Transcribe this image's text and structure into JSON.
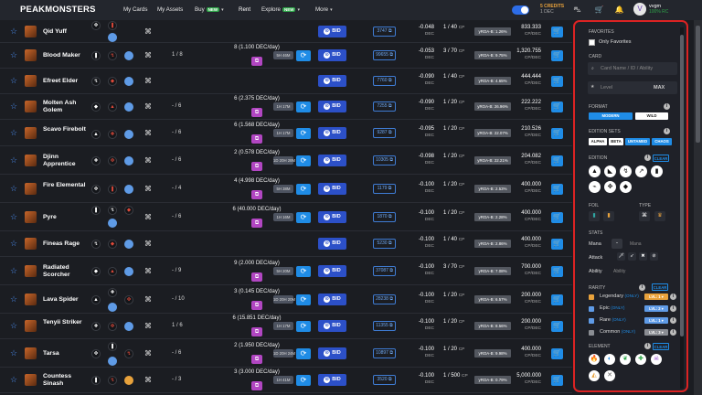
{
  "nav": {
    "logo": "PEAKMONSTERS",
    "items": [
      {
        "label": "My Cards"
      },
      {
        "label": "My Assets"
      },
      {
        "label": "Buy",
        "badge": "NEW"
      },
      {
        "label": "Rent"
      },
      {
        "label": "Explore",
        "badge": "NEW"
      },
      {
        "label": "More"
      }
    ],
    "credits_line1": "5 CREDITS",
    "credits_line2": "1 DEC",
    "user_initial": "V",
    "username": "vvgm",
    "rc": "100% RC"
  },
  "rows": [
    {
      "name": "Qid Yuff",
      "own": "",
      "rent": "",
      "rent_tag": "",
      "qty": "3747",
      "bc": "-0.048",
      "unit": "DEC",
      "levels": "1 / 40",
      "cp": "CP",
      "yield": "yROA-B: 1.26%",
      "price": "833.333",
      "price_unit": "CP/DEC"
    },
    {
      "name": "Blood Maker",
      "own": "1 / 8",
      "rent": "8 (1.100 DEC/day)",
      "rent_tag": "5H 46M",
      "qty": "99655",
      "bc": "-0.053",
      "unit": "DEC",
      "levels": "3 / 70",
      "cp": "CP",
      "yield": "yROA-B: 9.75%",
      "price": "1,320.755",
      "price_unit": "CP/DEC"
    },
    {
      "name": "Efreet Elder",
      "own": "",
      "rent": "",
      "rent_tag": "",
      "qty": "7760",
      "bc": "-0.090",
      "unit": "DEC",
      "levels": "1 / 40",
      "cp": "CP",
      "yield": "yROA-B: 4.65%",
      "price": "444.444",
      "price_unit": "CP/DEC"
    },
    {
      "name": "Molten Ash Golem",
      "own": "- / 6",
      "rent": "6 (2.375 DEC/day)",
      "rent_tag": "1H 17M",
      "qty": "7255",
      "bc": "-0.090",
      "unit": "DEC",
      "levels": "1 / 20",
      "cp": "CP",
      "yield": "yROA-B: 26.96%",
      "price": "222.222",
      "price_unit": "CP/DEC"
    },
    {
      "name": "Scavo Firebolt",
      "own": "- / 6",
      "rent": "6 (1.568 DEC/day)",
      "rent_tag": "1H 17M",
      "qty": "9287",
      "bc": "-0.095",
      "unit": "DEC",
      "levels": "1 / 20",
      "cp": "CP",
      "yield": "yROA-B: 22.07%",
      "price": "210.526",
      "price_unit": "CP/DEC"
    },
    {
      "name": "Djinn Apprentice",
      "own": "- / 6",
      "rent": "2 (0.578 DEC/day)",
      "rent_tag": "1D 20H 28M",
      "qty": "10305",
      "bc": "-0.098",
      "unit": "DEC",
      "levels": "1 / 20",
      "cp": "CP",
      "yield": "yROA-B: 22.21%",
      "price": "204.082",
      "price_unit": "CP/DEC"
    },
    {
      "name": "Fire Elemental",
      "own": "- / 4",
      "rent": "4 (4.998 DEC/day)",
      "rent_tag": "5H 38M",
      "qty": "1179",
      "bc": "-0.100",
      "unit": "DEC",
      "levels": "1 / 20",
      "cp": "CP",
      "yield": "yROA-B: 2.53%",
      "price": "400.000",
      "price_unit": "CP/DEC"
    },
    {
      "name": "Pyre",
      "own": "- / 6",
      "rent": "6 (40.000 DEC/day)",
      "rent_tag": "1H 16M",
      "qty": "1870",
      "bc": "-0.100",
      "unit": "DEC",
      "levels": "1 / 20",
      "cp": "CP",
      "yield": "yROA-B: 2.28%",
      "price": "400.000",
      "price_unit": "CP/DEC"
    },
    {
      "name": "Fineas Rage",
      "own": "",
      "rent": "",
      "rent_tag": "",
      "qty": "5230",
      "bc": "-0.100",
      "unit": "DEC",
      "levels": "1 / 40",
      "cp": "CP",
      "yield": "yROA-B: 2.86%",
      "price": "400.000",
      "price_unit": "CP/DEC"
    },
    {
      "name": "Radiated Scorcher",
      "own": "- / 9",
      "rent": "9 (2.000 DEC/day)",
      "rent_tag": "5H 20M",
      "qty": "37087",
      "bc": "-0.100",
      "unit": "DEC",
      "levels": "3 / 70",
      "cp": "CP",
      "yield": "yROA-B: 7.08%",
      "price": "700.000",
      "price_unit": "CP/DEC"
    },
    {
      "name": "Lava Spider",
      "own": "- / 10",
      "rent": "3 (0.145 DEC/day)",
      "rent_tag": "1D 20H 20M",
      "qty": "28238",
      "bc": "-0.100",
      "unit": "DEC",
      "levels": "1 / 20",
      "cp": "CP",
      "yield": "yROA-B: 6.57%",
      "price": "200.000",
      "price_unit": "CP/DEC"
    },
    {
      "name": "Tenyii Striker",
      "own": "1 / 6",
      "rent": "6 (15.851 DEC/day)",
      "rent_tag": "1H 17M",
      "qty": "11355",
      "bc": "-0.100",
      "unit": "DEC",
      "levels": "1 / 20",
      "cp": "CP",
      "yield": "yROA-B: 8.56%",
      "price": "200.000",
      "price_unit": "CP/DEC"
    },
    {
      "name": "Tarsa",
      "own": "- / 6",
      "rent": "2 (1.950 DEC/day)",
      "rent_tag": "1D 20H 24M",
      "qty": "10897",
      "bc": "-0.100",
      "unit": "DEC",
      "levels": "1 / 20",
      "cp": "CP",
      "yield": "yROA-B: 9.98%",
      "price": "400.000",
      "price_unit": "CP/DEC"
    },
    {
      "name": "Countess Sinash",
      "own": "- / 3",
      "rent": "3 (3.000 DEC/day)",
      "rent_tag": "1H 41M",
      "qty": "3520",
      "bc": "-0.100",
      "unit": "DEC",
      "levels": "1 / 500",
      "cp": "CP",
      "yield": "yROA-B: 0.79%",
      "price": "5,000.000",
      "price_unit": "CP/DEC"
    }
  ],
  "bid_label": "BID",
  "sidebar": {
    "favorites_title": "FAVORITES",
    "only_favorites": "Only Favorites",
    "card_title": "CARD",
    "card_placeholder": "Card Name / ID / Ability",
    "level_placeholder": "Level",
    "max_label": "MAX",
    "format_title": "FORMAT",
    "format_modern": "MODERN",
    "format_wild": "WILD",
    "edition_sets_title": "EDITION SETS",
    "edition_sets": [
      "ALPHA",
      "BETA",
      "UNTAMED",
      "CHAOS"
    ],
    "edition_title": "EDITION",
    "clear_label": "CLEAR",
    "foil_title": "FOIL",
    "type_title": "TYPE",
    "stats_title": "STATS",
    "mana_label": "Mana",
    "mana_placeholder": "Mana",
    "attack_label": "Attack",
    "ability_label": "Ability",
    "ability_placeholder": "Ability",
    "rarity_title": "RARITY",
    "rarities": [
      {
        "name": "Legendary",
        "only": "(ONLY)",
        "lvl": "LVL: 1",
        "color": "#e8a23c"
      },
      {
        "name": "Epic",
        "only": "(ONLY)",
        "lvl": "LVL: 2",
        "color": "#5f9be6"
      },
      {
        "name": "Rare",
        "only": "(ONLY)",
        "lvl": "LVL: 1",
        "color": "#5f9be6"
      },
      {
        "name": "Common",
        "only": "(ONLY)",
        "lvl": "LVL: 3",
        "color": "#8a8d93"
      }
    ],
    "element_title": "ELEMENT"
  }
}
